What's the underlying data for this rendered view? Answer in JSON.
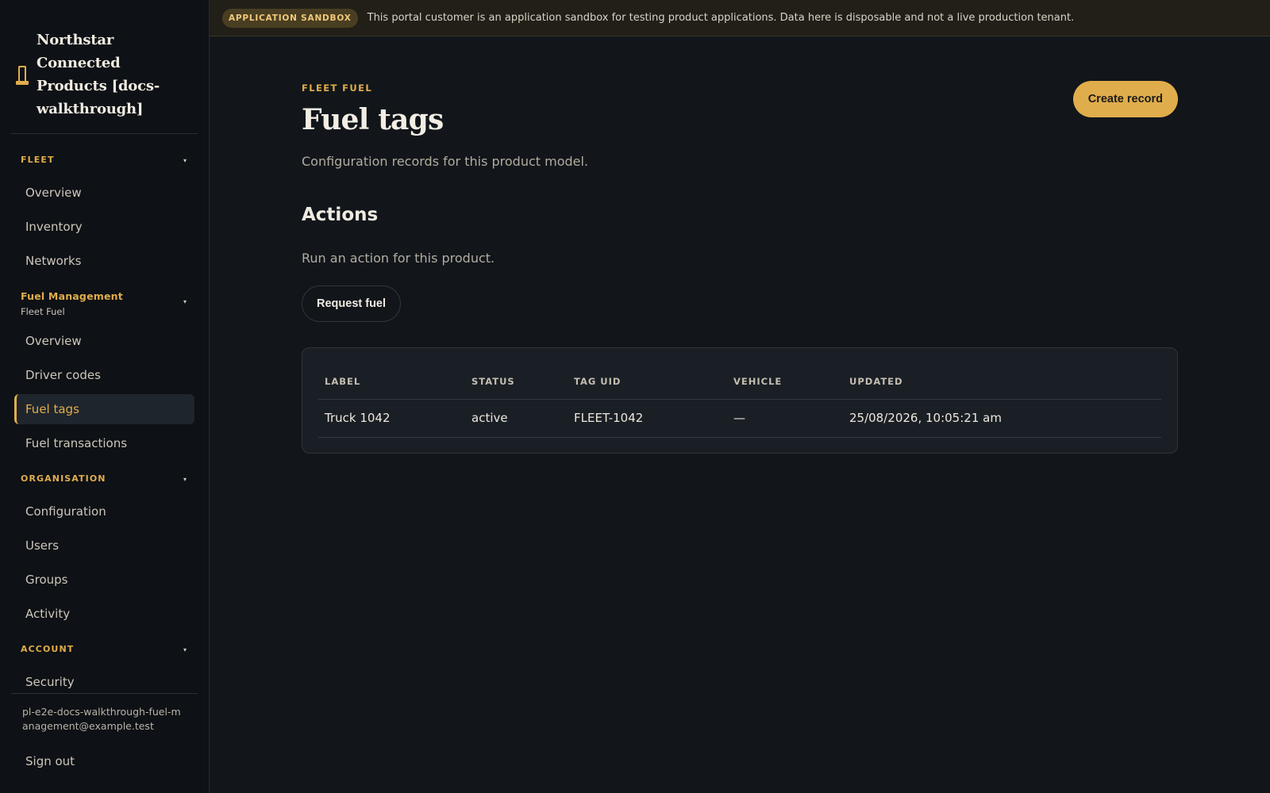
{
  "brand": {
    "title": "Northstar Connected Products [docs-walkthrough]",
    "icon": "fuel-pump-icon"
  },
  "sidebar": {
    "fleet": {
      "label": "FLEET",
      "items": [
        {
          "label": "Overview"
        },
        {
          "label": "Inventory"
        },
        {
          "label": "Networks"
        }
      ]
    },
    "fuel": {
      "label": "Fuel Management",
      "sublabel": "Fleet Fuel",
      "items": [
        {
          "label": "Overview"
        },
        {
          "label": "Driver codes"
        },
        {
          "label": "Fuel tags"
        },
        {
          "label": "Fuel transactions"
        }
      ]
    },
    "organisation": {
      "label": "ORGANISATION",
      "items": [
        {
          "label": "Configuration"
        },
        {
          "label": "Users"
        },
        {
          "label": "Groups"
        },
        {
          "label": "Activity"
        }
      ]
    },
    "account": {
      "label": "ACCOUNT",
      "items": [
        {
          "label": "Security"
        }
      ]
    },
    "chevron": "▾",
    "user_email": "pl-e2e-docs-walkthrough-fuel-management@example.test",
    "sign_out": "Sign out"
  },
  "banner": {
    "badge": "APPLICATION SANDBOX",
    "text": "This portal customer is an application sandbox for testing product applications. Data here is disposable and not a live production tenant."
  },
  "page": {
    "eyebrow": "FLEET FUEL",
    "title": "Fuel tags",
    "subtitle": "Configuration records for this product model.",
    "create_label": "Create record"
  },
  "actions": {
    "title": "Actions",
    "subtitle": "Run an action for this product.",
    "request_label": "Request fuel"
  },
  "table": {
    "headers": [
      "LABEL",
      "STATUS",
      "TAG UID",
      "VEHICLE",
      "UPDATED"
    ],
    "rows": [
      [
        "Truck 1042",
        "active",
        "FLEET-1042",
        "—",
        "25/08/2026, 10:05:21 am"
      ]
    ]
  },
  "colors": {
    "accent": "#e0ad4c",
    "background": "#12161b",
    "sidebar": "#0e1115",
    "banner": "#221f18"
  }
}
